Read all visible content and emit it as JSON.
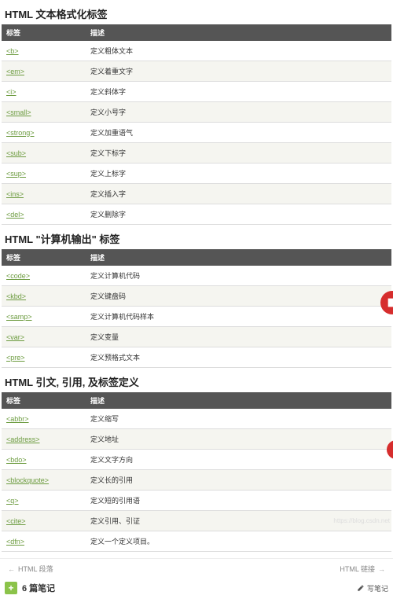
{
  "sections": [
    {
      "title": "HTML 文本格式化标签",
      "headers": {
        "tag": "标签",
        "desc": "描述"
      },
      "rows": [
        {
          "tag": "<b>",
          "desc": "定义粗体文本"
        },
        {
          "tag": "<em>",
          "desc": "定义着重文字"
        },
        {
          "tag": "<i>",
          "desc": "定义斜体字"
        },
        {
          "tag": "<small>",
          "desc": "定义小号字"
        },
        {
          "tag": "<strong>",
          "desc": "定义加重语气"
        },
        {
          "tag": "<sub>",
          "desc": "定义下标字"
        },
        {
          "tag": "<sup>",
          "desc": "定义上标字"
        },
        {
          "tag": "<ins>",
          "desc": "定义插入字"
        },
        {
          "tag": "<del>",
          "desc": "定义删除字"
        }
      ]
    },
    {
      "title": "HTML \"计算机输出\" 标签",
      "headers": {
        "tag": "标签",
        "desc": "描述"
      },
      "rows": [
        {
          "tag": "<code>",
          "desc": "定义计算机代码"
        },
        {
          "tag": "<kbd>",
          "desc": "定义键盘码"
        },
        {
          "tag": "<samp>",
          "desc": "定义计算机代码样本"
        },
        {
          "tag": "<var>",
          "desc": "定义变量"
        },
        {
          "tag": "<pre>",
          "desc": "定义预格式文本"
        }
      ]
    },
    {
      "title": "HTML 引文, 引用, 及标签定义",
      "headers": {
        "tag": "标签",
        "desc": "描述"
      },
      "rows": [
        {
          "tag": "<abbr>",
          "desc": "定义缩写"
        },
        {
          "tag": "<address>",
          "desc": "定义地址"
        },
        {
          "tag": "<bdo>",
          "desc": "定义文字方向"
        },
        {
          "tag": "<blockquote>",
          "desc": "定义长的引用"
        },
        {
          "tag": "<q>",
          "desc": "定义短的引用语"
        },
        {
          "tag": "<cite>",
          "desc": "定义引用、引证"
        },
        {
          "tag": "<dfn>",
          "desc": "定义一个定义项目。"
        }
      ]
    }
  ],
  "nav": {
    "prev": "HTML 段落",
    "next": "HTML 链接"
  },
  "notes": {
    "count_label": "6 篇笔记",
    "write_label": "写笔记",
    "plus": "+"
  },
  "watermark": "https://blog.csdn.net"
}
